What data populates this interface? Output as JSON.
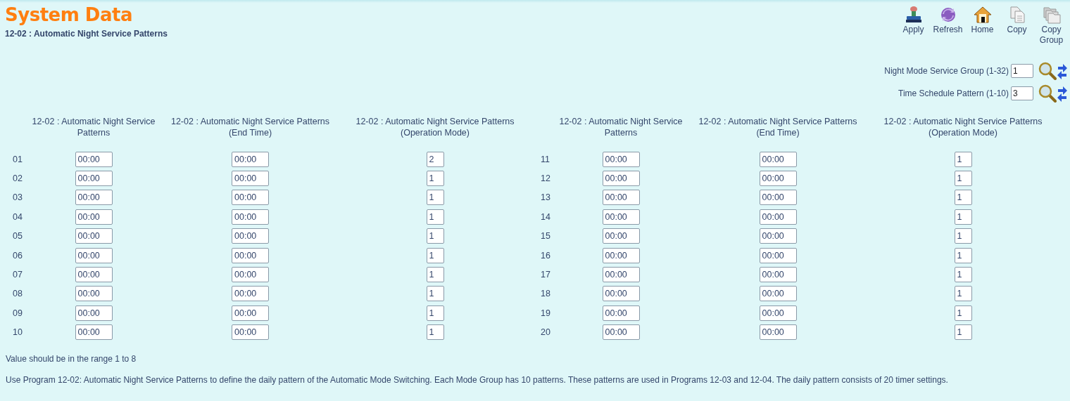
{
  "header": {
    "title": "System Data",
    "subtitle": "12-02 : Automatic Night Service Patterns"
  },
  "toolbar": [
    {
      "kind": "apply",
      "label": "Apply"
    },
    {
      "kind": "refresh",
      "label": "Refresh"
    },
    {
      "kind": "home",
      "label": "Home"
    },
    {
      "kind": "copy",
      "label": "Copy"
    },
    {
      "kind": "copygroup",
      "label": "Copy Group"
    }
  ],
  "filters": [
    {
      "label": "Night Mode Service Group (1-32)",
      "value": "1"
    },
    {
      "label": "Time Schedule Pattern (1-10)",
      "value": "3"
    }
  ],
  "table": {
    "headers": [
      "12-02 : Automatic Night Service Patterns",
      "12-02 : Automatic Night Service Patterns (End Time)",
      "12-02 : Automatic Night Service Patterns (Operation Mode)",
      "12-02 : Automatic Night Service Patterns",
      "12-02 : Automatic Night Service Patterns (End Time)",
      "12-02 : Automatic Night Service Patterns (Operation Mode)"
    ],
    "rows": [
      [
        "01",
        "00:00",
        "00:00",
        "2",
        "11",
        "00:00",
        "00:00",
        "1"
      ],
      [
        "02",
        "00:00",
        "00:00",
        "1",
        "12",
        "00:00",
        "00:00",
        "1"
      ],
      [
        "03",
        "00:00",
        "00:00",
        "1",
        "13",
        "00:00",
        "00:00",
        "1"
      ],
      [
        "04",
        "00:00",
        "00:00",
        "1",
        "14",
        "00:00",
        "00:00",
        "1"
      ],
      [
        "05",
        "00:00",
        "00:00",
        "1",
        "15",
        "00:00",
        "00:00",
        "1"
      ],
      [
        "06",
        "00:00",
        "00:00",
        "1",
        "16",
        "00:00",
        "00:00",
        "1"
      ],
      [
        "07",
        "00:00",
        "00:00",
        "1",
        "17",
        "00:00",
        "00:00",
        "1"
      ],
      [
        "08",
        "00:00",
        "00:00",
        "1",
        "18",
        "00:00",
        "00:00",
        "1"
      ],
      [
        "09",
        "00:00",
        "00:00",
        "1",
        "19",
        "00:00",
        "00:00",
        "1"
      ],
      [
        "10",
        "00:00",
        "00:00",
        "1",
        "20",
        "00:00",
        "00:00",
        "1"
      ]
    ]
  },
  "hint": "Value should be in the range 1 to 8",
  "description": "Use Program 12-02: Automatic Night Service Patterns to define the daily pattern of the Automatic Mode Switching. Each Mode Group has 10 patterns. These patterns are used in Programs 12-03 and 12-04. The daily pattern consists of 20 timer settings."
}
